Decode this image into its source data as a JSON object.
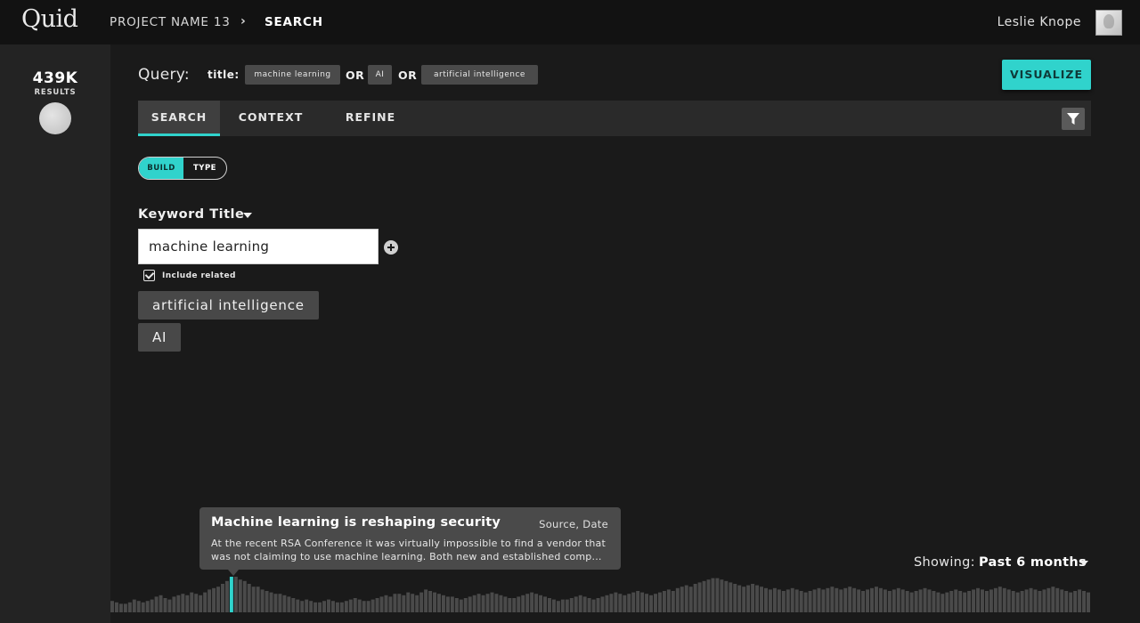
{
  "app": {
    "logo": "Quid",
    "breadcrumb": {
      "project": "PROJECT NAME 13",
      "separator": "›",
      "current": "SEARCH"
    },
    "user": {
      "name": "Leslie Knope"
    }
  },
  "sidebar": {
    "results_count": "439K",
    "results_label": "RESULTS"
  },
  "query": {
    "label": "Query:",
    "field": "title:",
    "terms": [
      "machine learning",
      "AI",
      "artificial intelligence"
    ],
    "operators": [
      "OR",
      "OR"
    ],
    "visualize_label": "VISUALIZE"
  },
  "tabs": [
    {
      "label": "SEARCH",
      "active": true
    },
    {
      "label": "CONTEXT",
      "active": false
    },
    {
      "label": "REFINE",
      "active": false
    }
  ],
  "mode_toggle": {
    "build": "BUILD",
    "type": "TYPE",
    "selected": "BUILD"
  },
  "keyword": {
    "title": "Keyword Title",
    "input_value": "machine learning",
    "include_related_label": "Include related",
    "include_related_checked": true,
    "related_terms": [
      "artificial intelligence",
      "AI"
    ]
  },
  "tooltip": {
    "title": "Machine learning is reshaping security",
    "meta": "Source, Date",
    "body": "At the recent RSA Conference it was virtually impossible to find a vendor that was not claiming to use machine learning. Both new and established comp..."
  },
  "timeline": {
    "showing_label": "Showing:",
    "showing_value": "Past 6 months",
    "bar_color": "#4a4a4a",
    "highlight_color": "#30d3cc",
    "highlight_index": 27,
    "values": [
      8,
      7,
      6,
      6,
      7,
      9,
      8,
      7,
      8,
      9,
      11,
      12,
      10,
      9,
      11,
      12,
      13,
      12,
      14,
      13,
      12,
      14,
      16,
      17,
      18,
      20,
      22,
      24,
      25,
      23,
      22,
      20,
      18,
      18,
      16,
      15,
      14,
      13,
      13,
      12,
      11,
      10,
      9,
      8,
      9,
      8,
      7,
      7,
      8,
      9,
      8,
      7,
      7,
      8,
      9,
      10,
      9,
      8,
      8,
      9,
      10,
      11,
      12,
      11,
      13,
      13,
      12,
      14,
      13,
      12,
      14,
      16,
      15,
      14,
      13,
      12,
      11,
      11,
      10,
      9,
      10,
      11,
      12,
      13,
      12,
      13,
      14,
      13,
      12,
      11,
      10,
      10,
      11,
      12,
      13,
      14,
      13,
      12,
      11,
      10,
      9,
      8,
      9,
      9,
      10,
      11,
      12,
      11,
      10,
      9,
      10,
      11,
      12,
      13,
      14,
      13,
      12,
      13,
      14,
      15,
      14,
      13,
      12,
      13,
      14,
      15,
      16,
      15,
      17,
      18,
      19,
      18,
      20,
      21,
      22,
      23,
      24,
      24,
      23,
      22,
      21,
      20,
      19,
      18,
      19,
      20,
      19,
      18,
      17,
      16,
      17,
      16,
      15,
      16,
      17,
      16,
      15,
      14,
      15,
      16,
      17,
      16,
      17,
      18,
      17,
      16,
      17,
      18,
      17,
      16,
      15,
      16,
      17,
      18,
      17,
      16,
      15,
      16,
      17,
      16,
      15,
      14,
      15,
      16,
      17,
      16,
      15,
      14,
      13,
      14,
      15,
      16,
      15,
      14,
      15,
      16,
      17,
      16,
      15,
      16,
      17,
      18,
      17,
      16,
      15,
      14,
      15,
      16,
      17,
      16,
      15,
      16,
      17,
      18,
      17,
      16,
      15,
      14,
      15,
      16,
      15,
      14
    ]
  }
}
